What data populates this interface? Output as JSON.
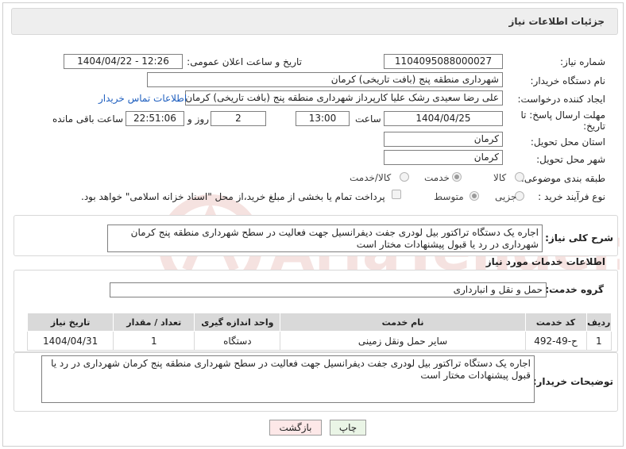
{
  "header": {
    "title": "جزئیات اطلاعات نیاز"
  },
  "fields": {
    "need_number": {
      "label": "شماره نیاز:",
      "value": "1104095088000027"
    },
    "announce_datetime": {
      "label": "تاریخ و ساعت اعلان عمومی:",
      "value": "1404/04/22 - 12:26"
    },
    "buyer_org": {
      "label": "نام دستگاه خریدار:",
      "value": "شهرداری منطقه پنج (بافت تاریخی) کرمان"
    },
    "requester": {
      "label": "ایجاد کننده درخواست:",
      "value": "علی رضا سعیدی رشک علیا کارپرداز شهرداری منطقه پنج (بافت تاریخی) کرمان"
    },
    "contact_link": "اطلاعات تماس خریدار",
    "deadline": {
      "label_line1": "مهلت ارسال پاسخ: تا",
      "label_line2": "تاریخ:",
      "date": "1404/04/25",
      "time_label": "ساعت",
      "time": "13:00",
      "days": "2",
      "days_label": "روز و",
      "remaining": "22:51:06",
      "remaining_label": "ساعت باقی مانده"
    },
    "province": {
      "label": "استان محل تحویل:",
      "value": "کرمان"
    },
    "city": {
      "label": "شهر محل تحویل:",
      "value": "کرمان"
    },
    "category": {
      "label": "طبقه بندی موضوعی:",
      "options": [
        "کالا",
        "خدمت",
        "کالا/خدمت"
      ],
      "selected": "خدمت"
    },
    "process_type": {
      "label": "نوع فرآیند خرید :",
      "options": [
        "جزیی",
        "متوسط"
      ],
      "selected": "متوسط",
      "payment_note": "پرداخت تمام یا بخشی از مبلغ خرید،از محل \"اسناد خزانه اسلامی\" خواهد بود."
    }
  },
  "description": {
    "label": "شرح کلی نیاز:",
    "text": "اجاره یک دستگاه تراکتور بیل لودری جفت دیفرانسیل جهت فعالیت در سطح شهرداری منطقه پنج کرمان شهرداری در رد یا قبول پیشنهادات مختار است"
  },
  "services": {
    "section_title": "اطلاعات خدمات مورد نیاز",
    "group_label": "گروه خدمت:",
    "group_value": "حمل و نقل و انبارداری",
    "columns": [
      "ردیف",
      "کد خدمت",
      "نام خدمت",
      "واحد اندازه گیری",
      "تعداد / مقدار",
      "تاریخ نیاز"
    ],
    "rows": [
      [
        "1",
        "ح-49-492",
        "سایر حمل ونقل زمینی",
        "دستگاه",
        "1",
        "1404/04/31"
      ]
    ]
  },
  "buyer_notes": {
    "label": "توضیحات خریدار:",
    "text": "اجاره یک دستگاه تراکتور بیل لودری جفت دیفرانسیل جهت فعالیت در سطح شهرداری منطقه پنج کرمان شهرداری در رد یا قبول پیشنهادات مختار است"
  },
  "buttons": {
    "print": "چاپ",
    "back": "بازگشت"
  },
  "watermark_text": "AriaTender.neT",
  "colors": {
    "link": "#1f5fbf",
    "back_button": "#fde8e8",
    "print_button": "#eaf5e6",
    "table_header": "#d9d9d9"
  }
}
